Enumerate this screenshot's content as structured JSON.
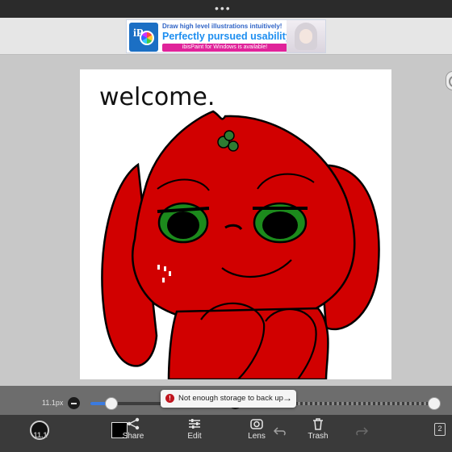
{
  "status": {
    "more_dots": "•••"
  },
  "ad": {
    "line1": "Draw high level illustrations intuitively!",
    "line2": "Perfectly pursued usability!",
    "line3": "ibisPaint for Windows is available!",
    "logo_text": "iP"
  },
  "canvas": {
    "handwritten_text": "welcome.",
    "bg_color": "#ffffff",
    "character_color": "#d10000"
  },
  "sliders": {
    "brush_size_label": "11.1px",
    "brush_size_fraction": 0.15,
    "opacity_fraction": 1.0
  },
  "toast": {
    "message": "Not enough storage to back up",
    "icon": "!"
  },
  "toolbar": {
    "brush_value": "11.1",
    "share_label": "Share",
    "edit_label": "Edit",
    "lens_label": "Lens",
    "trash_label": "Trash",
    "page_count": "2",
    "current_color": "#000000"
  }
}
